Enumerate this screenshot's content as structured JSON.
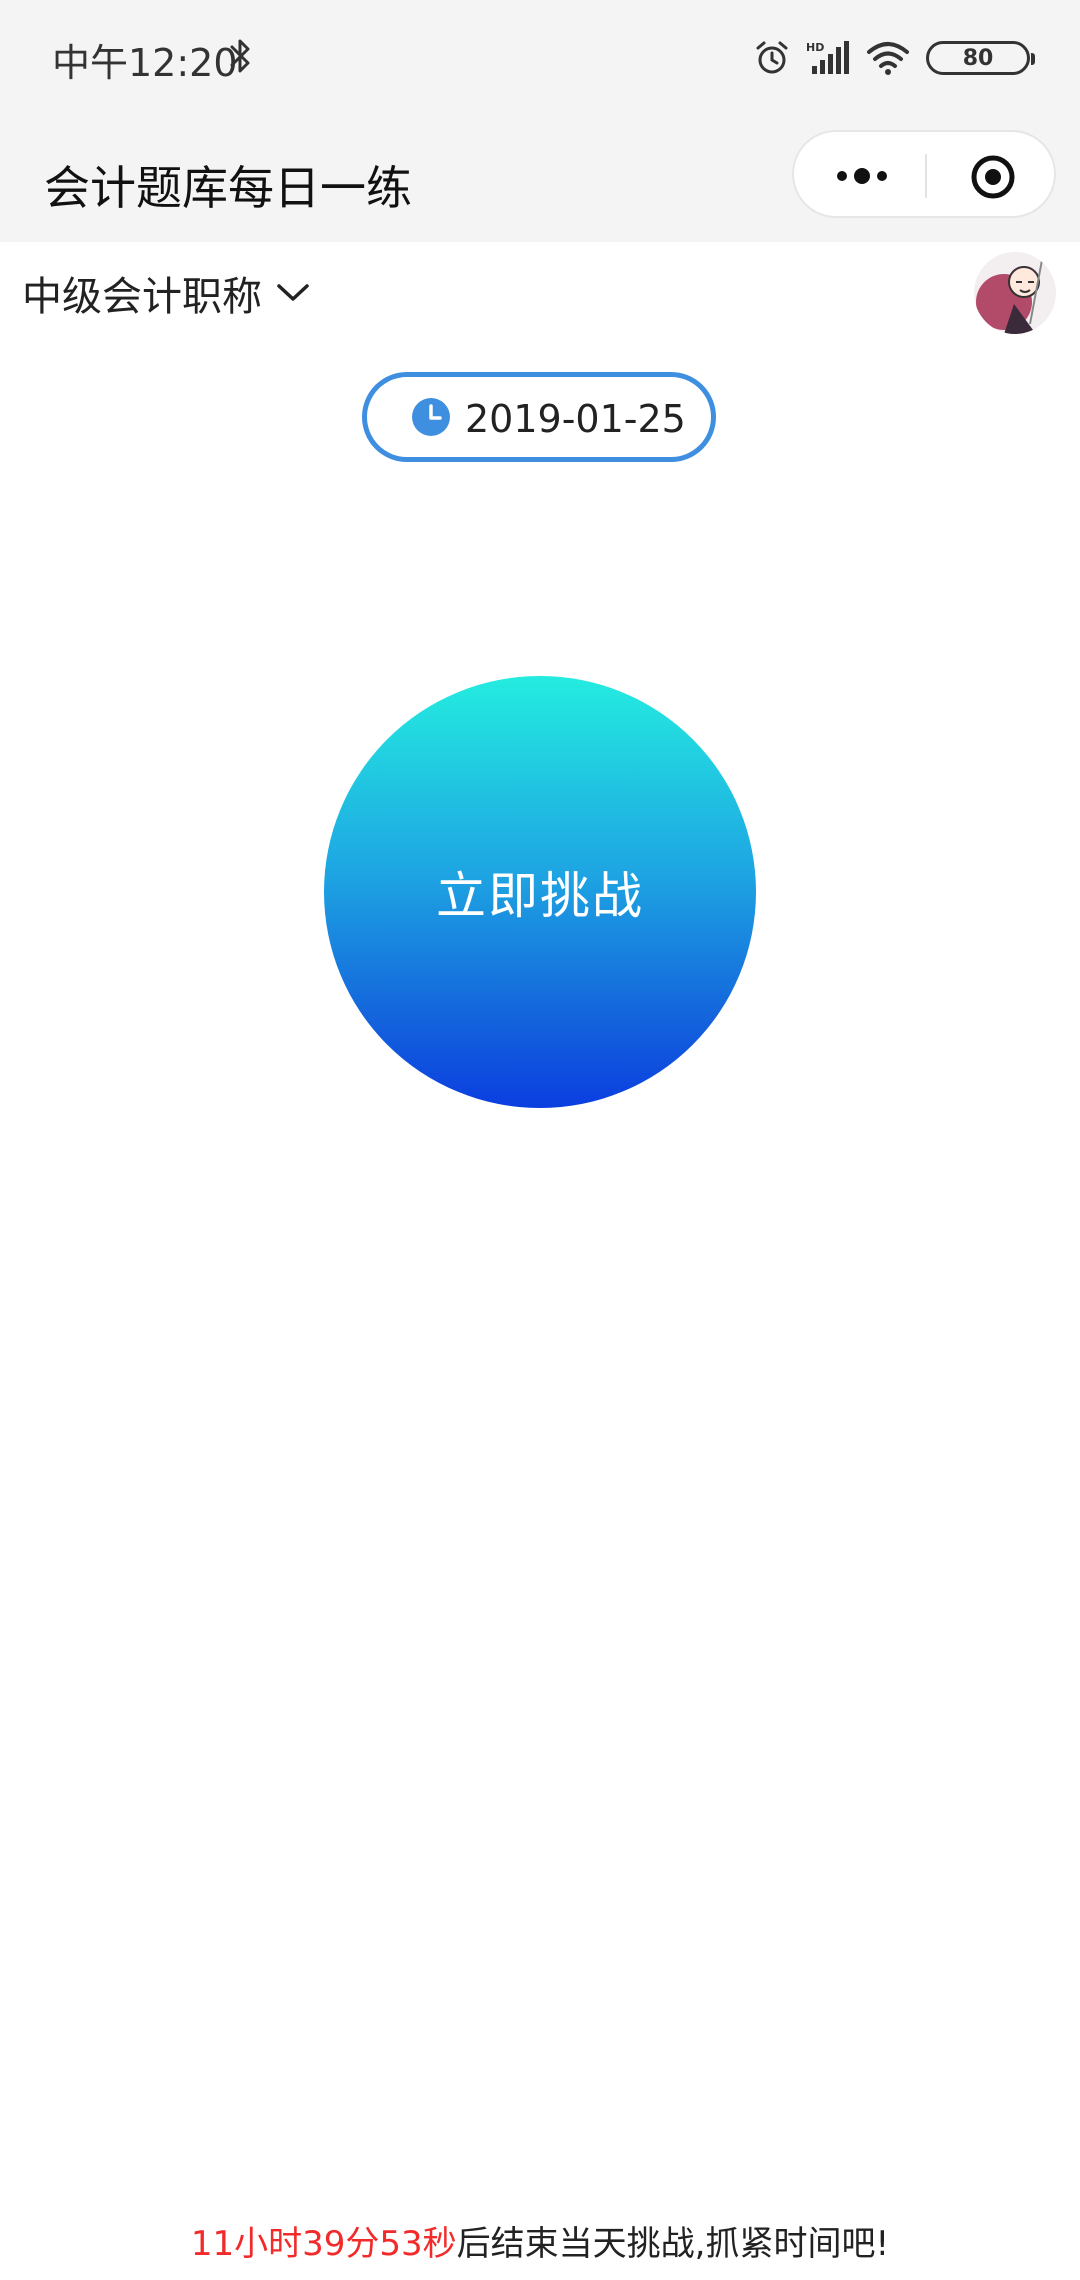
{
  "status_bar": {
    "time": "中午12:20",
    "battery": "80",
    "icons": [
      "bluetooth-icon",
      "alarm-icon",
      "hd-signal-icon",
      "wifi-icon",
      "battery-icon"
    ]
  },
  "nav": {
    "title": "会计题库每日一练",
    "icons": [
      "more-dots-icon",
      "close-target-icon"
    ]
  },
  "category": {
    "label": "中级会计职称",
    "icon": "chevron-down-icon"
  },
  "date": {
    "value": "2019-01-25",
    "icon": "clock-icon"
  },
  "challenge": {
    "label": "立即挑战"
  },
  "footer": {
    "countdown": "11小时39分53秒",
    "message": "后结束当天挑战,抓紧时间吧!"
  },
  "colors": {
    "accent_blue": "#3f8fe0",
    "countdown_red": "#f22a2a",
    "gradient_top": "#24ece0",
    "gradient_bottom": "#0b3ee0",
    "bar_background": "#f4f4f4"
  }
}
